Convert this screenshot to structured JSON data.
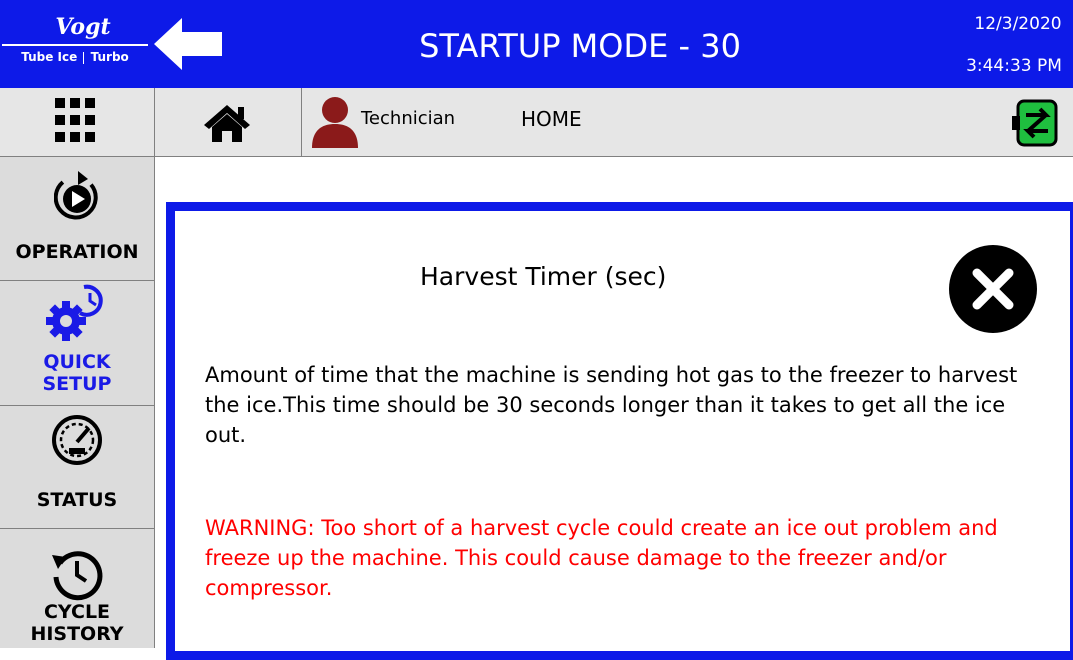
{
  "header": {
    "brand_top": "Vogt",
    "brand_bottom_left": "Tube Ice",
    "brand_bottom_right": "Turbo",
    "title": "STARTUP MODE - 30",
    "date": "12/3/2020",
    "time": "3:44:33 PM"
  },
  "navbar": {
    "user_label": "Technician",
    "page_label": "HOME"
  },
  "sidebar": {
    "items": [
      {
        "label": "OPERATION",
        "icon": "play-cycle-icon",
        "color": "#000000"
      },
      {
        "label_line1": "QUICK",
        "label_line2": "SETUP",
        "icon": "gear-clock-icon",
        "color": "#1a1ae6"
      },
      {
        "label": "STATUS",
        "icon": "gauge-icon",
        "color": "#000000"
      },
      {
        "label_line1": "CYCLE",
        "label_line2": "HISTORY",
        "icon": "history-icon",
        "color": "#000000"
      }
    ]
  },
  "dialog": {
    "title": "Harvest Timer (sec)",
    "description": "Amount of time that the machine is sending hot gas to the freezer to harvest the ice.This time should be 30 seconds longer than it takes to get all the ice out.",
    "warning": "WARNING: Too short of a harvest cycle could create an ice out problem and freeze up the machine. This could cause damage to the freezer and/or compressor."
  },
  "colors": {
    "header_blue": "#0d1ae8",
    "warning_red": "#ff0000",
    "user_icon": "#8b1a1a",
    "switch_icon": "#1fbf3f"
  }
}
